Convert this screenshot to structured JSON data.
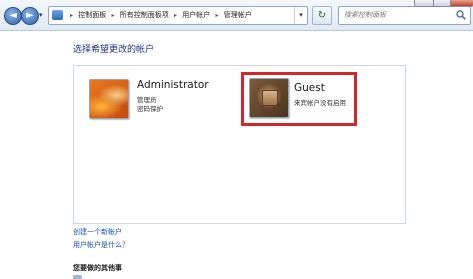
{
  "nav": {
    "back": "◄",
    "forward": "►",
    "dropdown": "▾"
  },
  "address": {
    "crumbs": [
      "控制面板",
      "所有控制面板项",
      "用户帐户",
      "管理帐户"
    ],
    "separator": "▸",
    "dropdown": "▾"
  },
  "refresh": "↻",
  "search": {
    "placeholder": "搜索控制面板"
  },
  "page": {
    "heading": "选择希望更改的帐户"
  },
  "accounts": [
    {
      "name": "Administrator",
      "type": "管理员",
      "status": "密码保护",
      "avatar": "orange-flower-picture"
    },
    {
      "name": "Guest",
      "status": "来宾帐户没有启用",
      "avatar": "suitcase-picture",
      "highlighted": true,
      "highlight_color": "#d0262c"
    }
  ],
  "links": {
    "create": "创建一个新帐户",
    "what_is": "用户帐户是什么？"
  },
  "more": {
    "heading": "您要做的其他事"
  },
  "colors": {
    "link": "#1c4fb8",
    "heading": "#1e3287",
    "highlight": "#d0262c"
  }
}
